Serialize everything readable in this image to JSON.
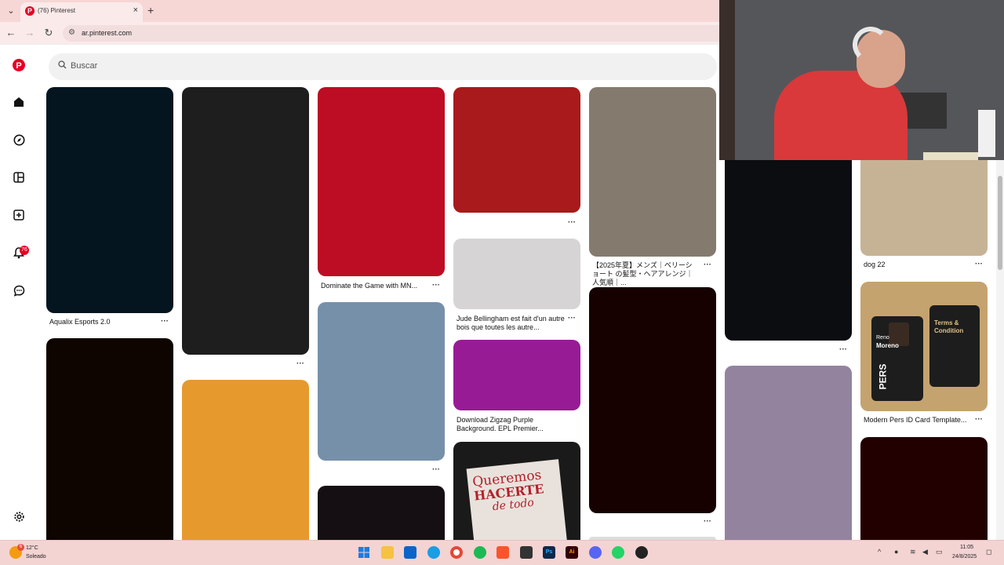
{
  "browser": {
    "tab_title": "(76) Pinterest",
    "tab_favicon": "P",
    "tab_close": "×",
    "new_tab": "+",
    "tab_menu": "⌄",
    "url": "ar.pinterest.com"
  },
  "rail": {
    "notification_count": "76"
  },
  "search": {
    "placeholder": "Buscar"
  },
  "pins": [
    {
      "title": "Aqualix Esports 2.0",
      "color": "#041520"
    },
    {
      "title": "",
      "color": "#1e1e1e"
    },
    {
      "title": "Dominate the Game with MN...",
      "color": "#bd0d24"
    },
    {
      "title": "",
      "color": "#a81a1b"
    },
    {
      "title": "【2025年夏】メンズ｜ベリーショート の髪型・ヘアアレンジ｜人気順｜...",
      "color": "#857a6e"
    },
    {
      "title": "",
      "color": "#0c0d10"
    },
    {
      "title": "dog 22",
      "color": "#c6b396"
    },
    {
      "title": "Jude Bellingham est fait d'un autre bois que toutes les autre...",
      "color": "#d7d4d5"
    },
    {
      "title": "Download Zigzag Purple Background. EPL Premier...",
      "color": "#981b96"
    },
    {
      "title": "",
      "color": "#0e0500"
    },
    {
      "title": "",
      "color": "#e69a2d"
    },
    {
      "title": "",
      "color": "#7690aa"
    },
    {
      "title": "",
      "color": "#150f14"
    },
    {
      "title": "",
      "color": "#160000"
    },
    {
      "title": "",
      "color": "#93839f"
    },
    {
      "title": "Modern Pers ID Card Template...",
      "color": "#c5a36f"
    },
    {
      "title": "",
      "color": "#220000"
    },
    {
      "title": "",
      "color": "#1a1a1a"
    }
  ],
  "poster": {
    "line1": "Queremos",
    "line2": "HACERTE",
    "line3": "de todo"
  },
  "idcard": {
    "name1": "Reno",
    "name2": "Moreno",
    "brand": "PERS",
    "right1": "Terms &",
    "right2": "Condition"
  },
  "taskbar": {
    "weather_temp": "12°C",
    "weather_desc": "Soleado",
    "weather_badge": "6",
    "time": "11:05",
    "date": "24/8/2025"
  },
  "colors": {
    "brand": "#e60023",
    "taskbar": "#f4d3d3"
  }
}
